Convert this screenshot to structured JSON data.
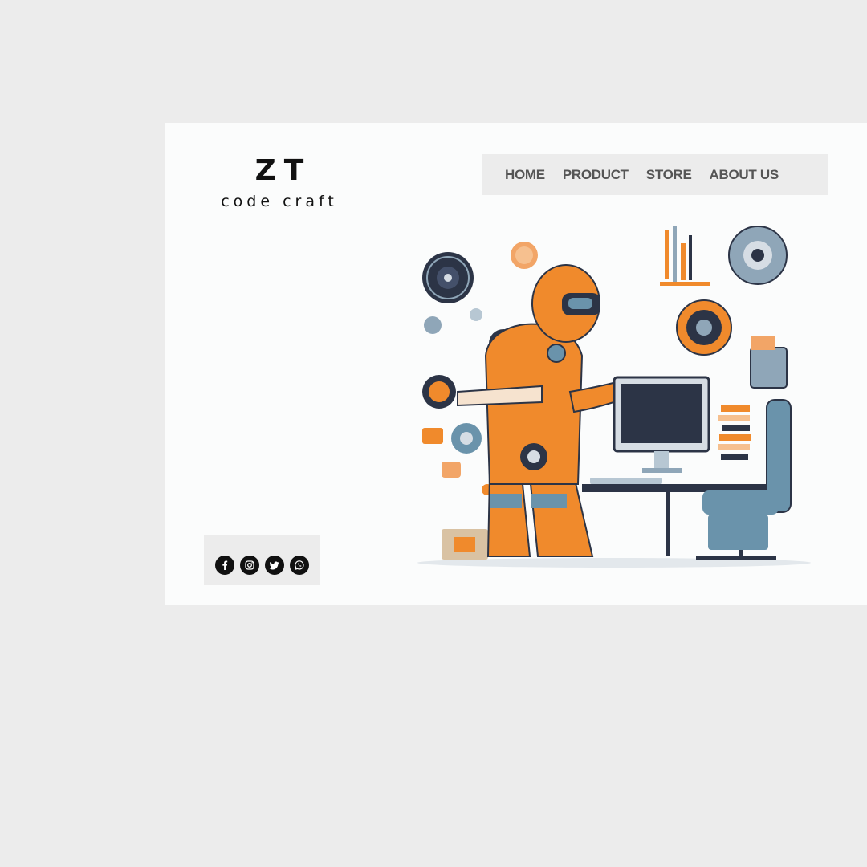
{
  "brand": {
    "title": "ZT",
    "subtitle": "code craft"
  },
  "nav": {
    "items": [
      "HOME",
      "PRODUCT",
      "STORE",
      "ABOUT US"
    ]
  },
  "social": {
    "icons": [
      "facebook-icon",
      "instagram-icon",
      "twitter-icon",
      "whatsapp-icon"
    ]
  },
  "hero": {
    "image": "astronaut-programmer-illustration"
  },
  "colors": {
    "background": "#ececec",
    "page": "#fbfcfc",
    "accent_orange": "#f08a2c",
    "steel_blue": "#6a93ab",
    "navy": "#2c3446"
  }
}
